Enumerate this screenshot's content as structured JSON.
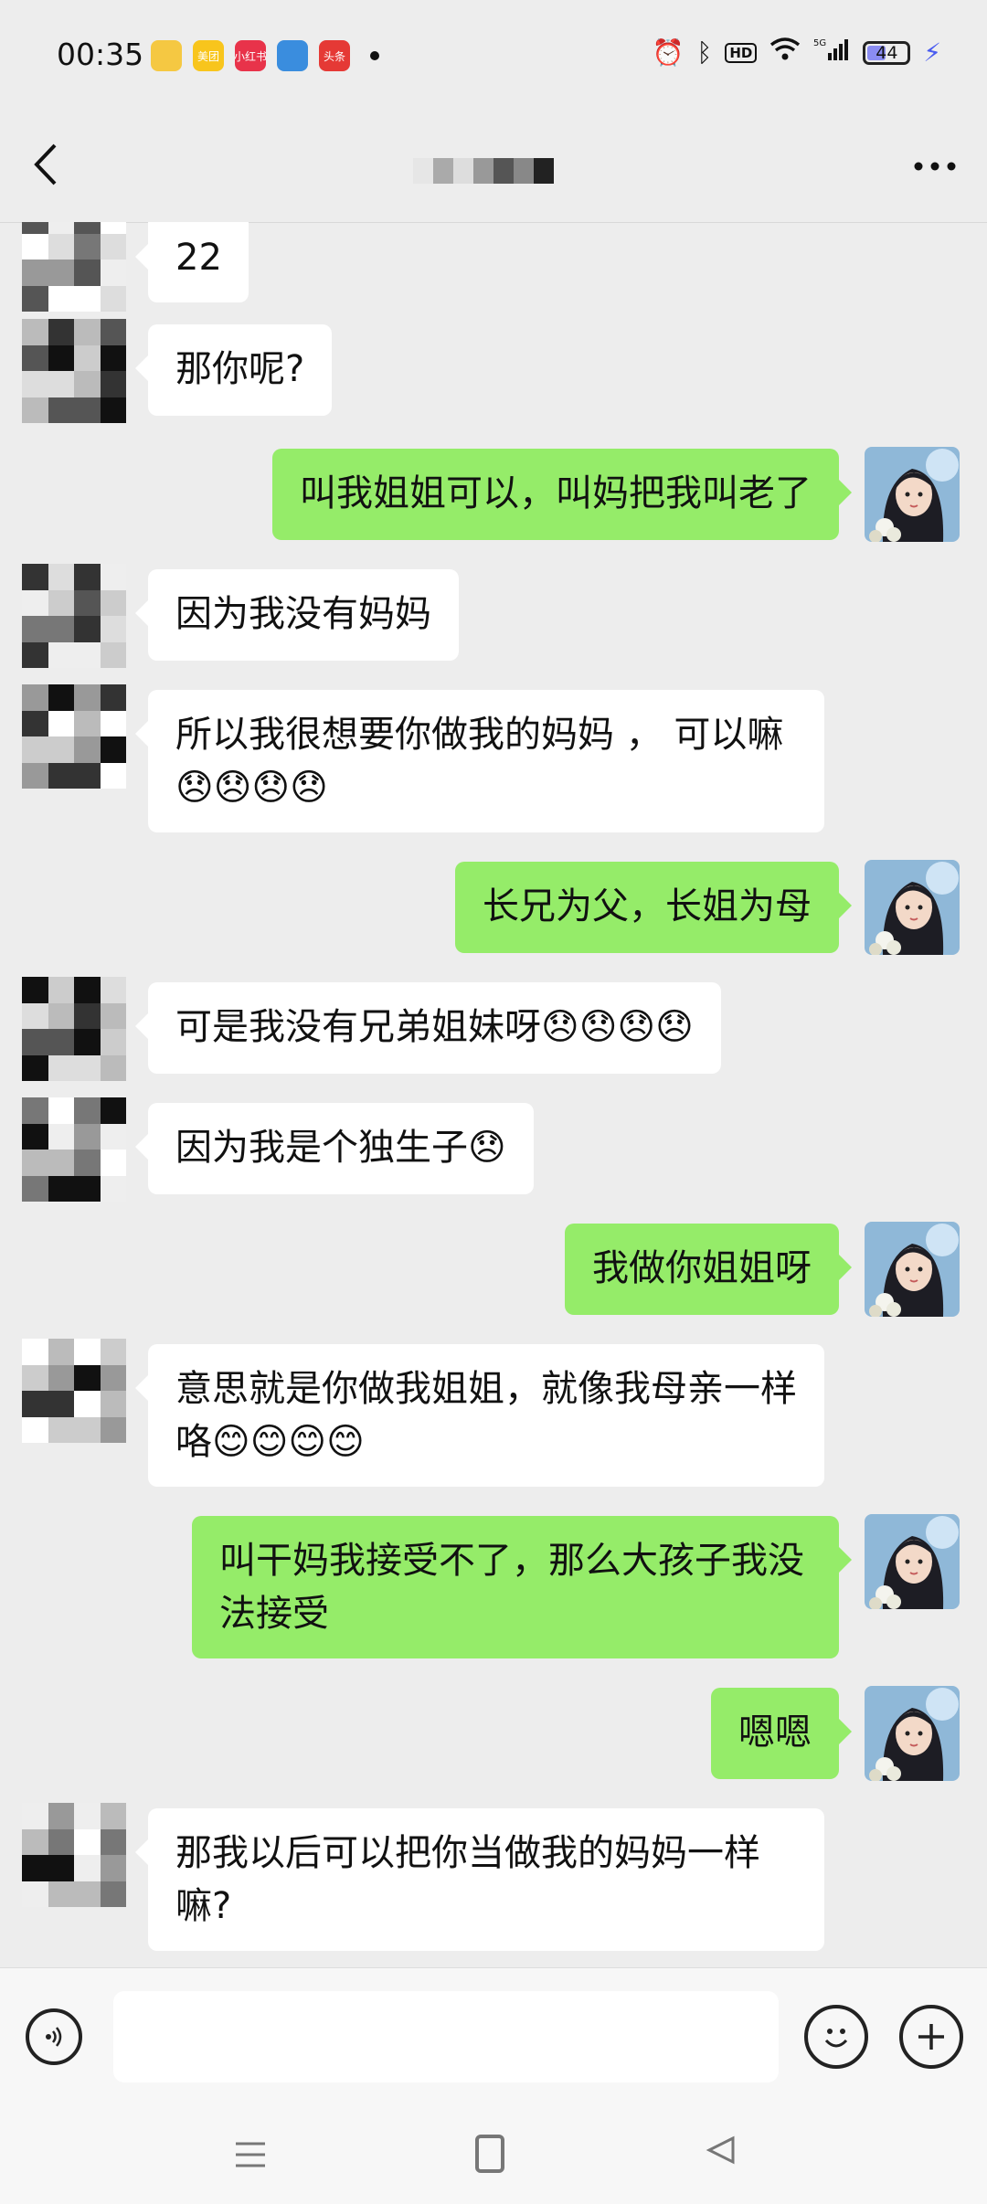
{
  "status_bar": {
    "time": "00:35",
    "apps": [
      {
        "name": "app-icon",
        "label": "",
        "color": "#f5c842"
      },
      {
        "name": "meituan-icon",
        "label": "美团",
        "color": "#f8c51c"
      },
      {
        "name": "xiaohongshu-icon",
        "label": "小红书",
        "color": "#e8334a"
      },
      {
        "name": "app-icon",
        "label": "",
        "color": "#3a8dde"
      },
      {
        "name": "toutiao-icon",
        "label": "头条",
        "color": "#e53935"
      }
    ],
    "battery": "44"
  },
  "header": {
    "back_icon": "chevron-left-icon",
    "more_icon": "more-dots-icon"
  },
  "messages": [
    {
      "dir": "in",
      "text": "22",
      "top": 0
    },
    {
      "dir": "in",
      "text": "那你呢?",
      "top": 0
    },
    {
      "dir": "out",
      "text": "叫我姐姐可以，叫妈把我叫老了",
      "top": 0
    },
    {
      "dir": "in",
      "text": "因为我没有妈妈",
      "top": 0
    },
    {
      "dir": "in",
      "text": "所以我很想要你做我的妈妈 ， 可以嘛😞😞😞😞",
      "top": 0
    },
    {
      "dir": "out",
      "text": "长兄为父，长姐为母",
      "top": 0
    },
    {
      "dir": "in",
      "text": "可是我没有兄弟姐妹呀😞😞😞😞",
      "top": 0
    },
    {
      "dir": "in",
      "text": "因为我是个独生子😞",
      "top": 0
    },
    {
      "dir": "out",
      "text": "我做你姐姐呀",
      "top": 0
    },
    {
      "dir": "in",
      "text": "意思就是你做我姐姐，就像我母亲一样咯😊😊😊😊",
      "top": 0
    },
    {
      "dir": "out",
      "text": "叫干妈我接受不了，那么大孩子我没法接受",
      "top": 0
    },
    {
      "dir": "out",
      "text": "嗯嗯",
      "top": 0
    },
    {
      "dir": "in",
      "text": "那我以后可以把你当做我的妈妈一样嘛?",
      "top": 0
    }
  ],
  "input": {
    "placeholder": "",
    "voice_icon": "voice-icon",
    "emoji_icon": "emoji-icon",
    "plus_icon": "plus-icon"
  },
  "colors": {
    "incoming_bubble": "#ffffff",
    "outgoing_bubble": "#95ec69",
    "background": "#ededed"
  }
}
